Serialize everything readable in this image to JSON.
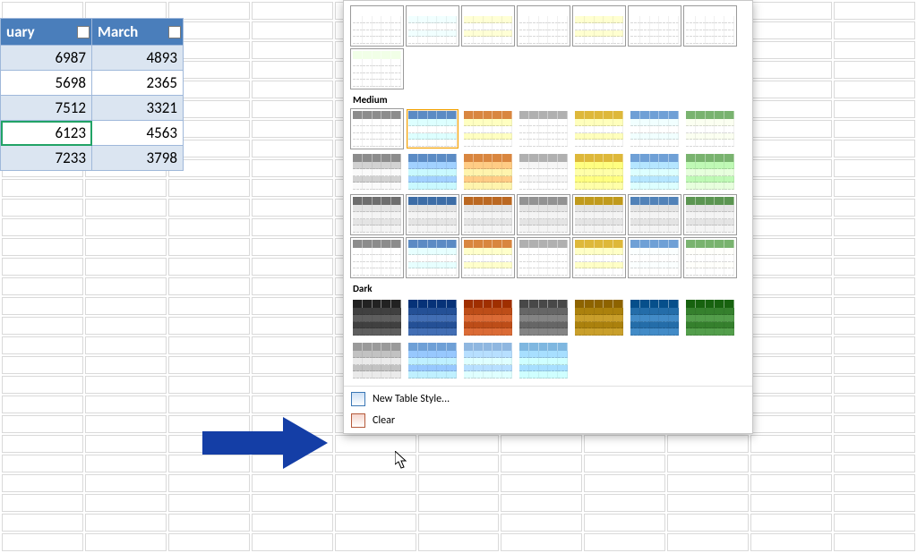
{
  "columns": {
    "c1": "uary",
    "c2": "March"
  },
  "rows": [
    {
      "a": "6987",
      "b": "4893",
      "band": true
    },
    {
      "a": "5698",
      "b": "2365",
      "band": false
    },
    {
      "a": "7512",
      "b": "3321",
      "band": true
    },
    {
      "a": "6123",
      "b": "4563",
      "band": false,
      "active_a": true
    },
    {
      "a": "7233",
      "b": "3798",
      "band": true
    }
  ],
  "gallery": {
    "labels": {
      "medium": "Medium",
      "dark": "Dark",
      "new": "New Table Style...",
      "clear": "Clear"
    },
    "light_top": {
      "palettes": [
        "#8c8c8c",
        "#5b8bc4",
        "#d9863f",
        "#b0b0b0",
        "#deb83a",
        "#6fa0d6",
        "#79b36f"
      ]
    },
    "light_alone": [
      "#79b36f"
    ],
    "medium_palettes": [
      "#8c8c8c",
      "#5b8bc4",
      "#d9863f",
      "#b0b0b0",
      "#deb83a",
      "#6fa0d6",
      "#79b36f"
    ],
    "medium_selected_index": 1,
    "dark_palettes_row1": [
      "#4a4a4a",
      "#2e5aa0",
      "#c75722",
      "#707070",
      "#b58b17",
      "#2e77b3",
      "#3f8a37"
    ],
    "dark_palettes_row2": [
      "#9a9a9a",
      "#6fa0d6",
      "#8fb7e0",
      "#7fb7e0"
    ]
  }
}
